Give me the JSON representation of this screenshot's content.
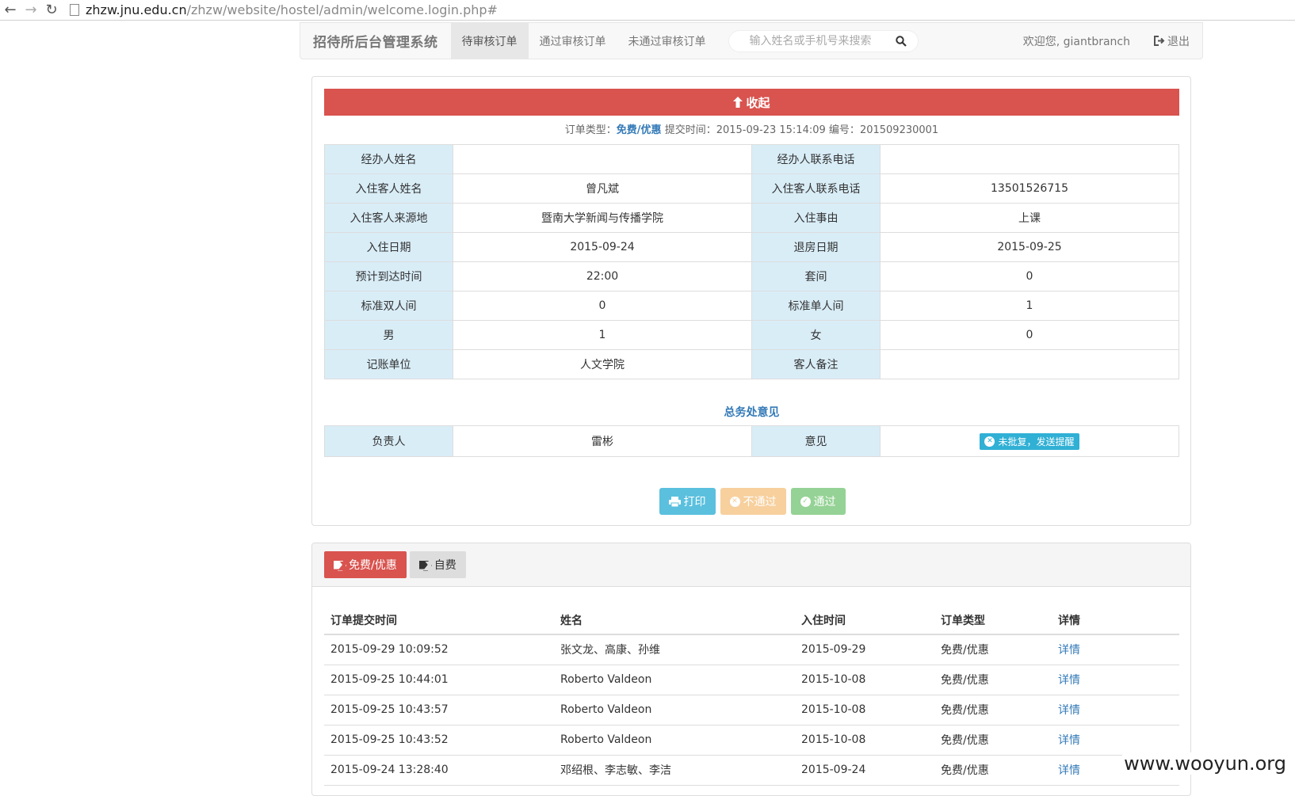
{
  "browser": {
    "url_host": "zhzw.jnu.edu.cn",
    "url_path": "/zhzw/website/hostel/admin/welcome.login.php#"
  },
  "navbar": {
    "brand": "招待所后台管理系统",
    "tabs": [
      {
        "label": "待审核订单",
        "active": true
      },
      {
        "label": "通过审核订单",
        "active": false
      },
      {
        "label": "未通过审核订单",
        "active": false
      }
    ],
    "search_placeholder": "输入姓名或手机号来搜索",
    "welcome": "欢迎您, giantbranch",
    "logout": "退出"
  },
  "detail": {
    "collapse_label": "收起",
    "meta": {
      "type_label": "订单类型：",
      "type_value": "免费/优惠",
      "time_label": "提交时间：",
      "time_value": "2015-09-23 15:14:09",
      "id_label": "编号：",
      "id_value": "201509230001"
    },
    "rows": [
      {
        "l1": "经办人姓名",
        "v1": "",
        "l2": "经办人联系电话",
        "v2": ""
      },
      {
        "l1": "入住客人姓名",
        "v1": "曾凡斌",
        "l2": "入住客人联系电话",
        "v2": "13501526715"
      },
      {
        "l1": "入住客人来源地",
        "v1": "暨南大学新闻与传播学院",
        "l2": "入住事由",
        "v2": "上课"
      },
      {
        "l1": "入住日期",
        "v1": "2015-09-24",
        "l2": "退房日期",
        "v2": "2015-09-25"
      },
      {
        "l1": "预计到达时间",
        "v1": "22:00",
        "l2": "套间",
        "v2": "0"
      },
      {
        "l1": "标准双人间",
        "v1": "0",
        "l2": "标准单人间",
        "v2": "1"
      },
      {
        "l1": "男",
        "v1": "1",
        "l2": "女",
        "v2": "0"
      },
      {
        "l1": "记账单位",
        "v1": "人文学院",
        "l2": "客人备注",
        "v2": ""
      }
    ],
    "opinion": {
      "title": "总务处意见",
      "person_label": "负责人",
      "person_value": "雷彬",
      "opinion_label": "意见",
      "opinion_badge": "未批复，发送提醒"
    },
    "actions": {
      "print": "打印",
      "reject": "不通过",
      "pass": "通过"
    }
  },
  "orders": {
    "tabs": [
      "免费/优惠",
      "自费"
    ],
    "columns": [
      "订单提交时间",
      "姓名",
      "入住时间",
      "订单类型",
      "详情"
    ],
    "rows": [
      {
        "time": "2015-09-29 10:09:52",
        "name": "张文龙、高康、孙维",
        "checkin": "2015-09-29",
        "type": "免费/优惠",
        "detail": "详情"
      },
      {
        "time": "2015-09-25 10:44:01",
        "name": "Roberto Valdeon",
        "checkin": "2015-10-08",
        "type": "免费/优惠",
        "detail": "详情"
      },
      {
        "time": "2015-09-25 10:43:57",
        "name": "Roberto Valdeon",
        "checkin": "2015-10-08",
        "type": "免费/优惠",
        "detail": "详情"
      },
      {
        "time": "2015-09-25 10:43:52",
        "name": "Roberto Valdeon",
        "checkin": "2015-10-08",
        "type": "免费/优惠",
        "detail": "详情"
      },
      {
        "time": "2015-09-24 13:28:40",
        "name": "邓绍根、李志敏、李洁",
        "checkin": "2015-09-24",
        "type": "免费/优惠",
        "detail": "详情"
      }
    ]
  },
  "watermark": "www.wooyun.org",
  "colors": {
    "danger": "#d9534f",
    "info": "#5bc0de",
    "warning": "#f7d09e",
    "success": "#95d295",
    "label_bg": "#d9edf7",
    "link": "#337ab7"
  }
}
